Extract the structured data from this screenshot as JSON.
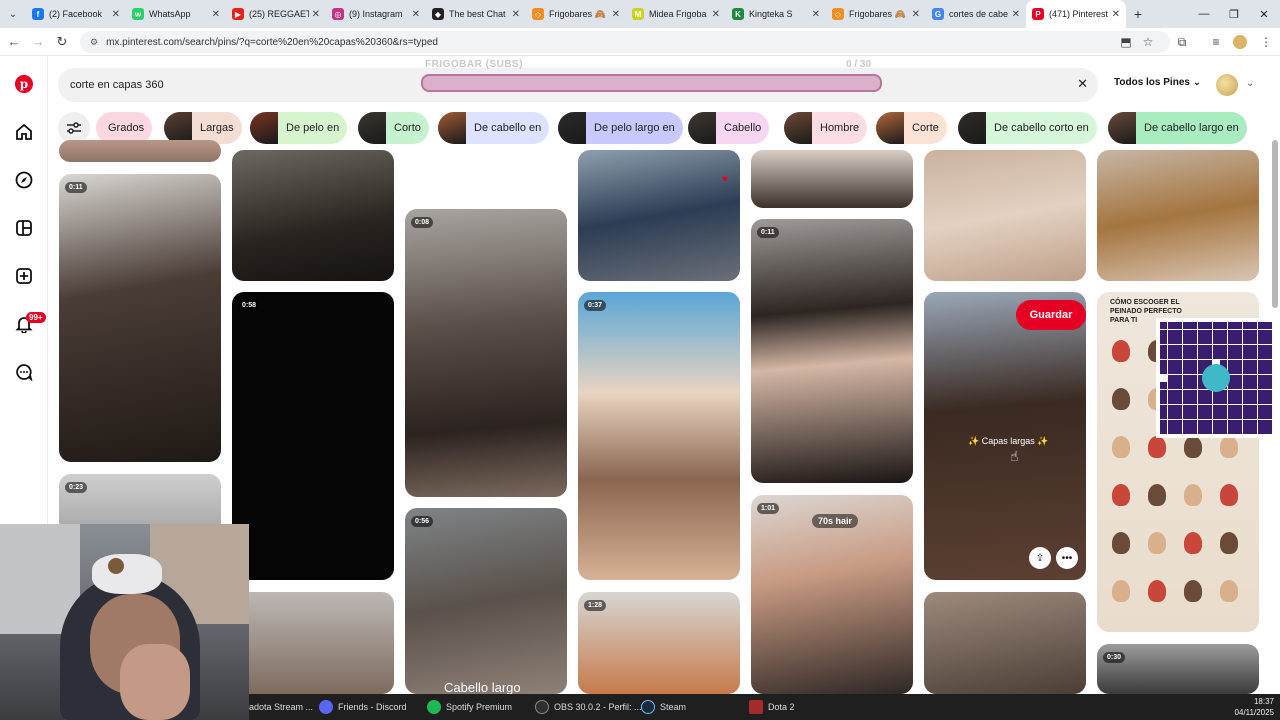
{
  "browser": {
    "tabs": [
      {
        "title": "(2) Facebook",
        "color": "#1877f2",
        "glyph": "f"
      },
      {
        "title": "WhatsApp",
        "color": "#25d366",
        "glyph": "w"
      },
      {
        "title": "(25) REGGAETO",
        "color": "#e62117",
        "glyph": "▶"
      },
      {
        "title": "(9) Instagram",
        "color": "#c13584",
        "glyph": "◎"
      },
      {
        "title": "The best Chat",
        "color": "#222222",
        "glyph": "◆"
      },
      {
        "title": "Frigobares 🙈",
        "color": "#f68b1e",
        "glyph": "◇"
      },
      {
        "title": "Midea Frigoba",
        "color": "#c7d31f",
        "glyph": "M"
      },
      {
        "title": "Kingteka S",
        "color": "#1c8a3e",
        "glyph": "K"
      },
      {
        "title": "Frigobares 🙈",
        "color": "#f68b1e",
        "glyph": "◇"
      },
      {
        "title": "cortes de cabe",
        "color": "#4285f4",
        "glyph": "G"
      },
      {
        "title": "(471) Pinterest",
        "color": "#e60023",
        "glyph": "P"
      }
    ],
    "url": "mx.pinterest.com/search/pins/?q=corte%20en%20capas%20360&rs=typed"
  },
  "search": {
    "query": "corte en capas 360",
    "filter": "Todos los Pines",
    "stream_overlay_label": "FRIGOBAR (SUBS)",
    "stream_overlay_count": "0 / 30"
  },
  "nav": {
    "notifications_badge": "99+"
  },
  "chips": [
    {
      "label": "Grados",
      "bg": "#fbd7e2",
      "thumb": null
    },
    {
      "label": "Largas",
      "bg": "#f4ded3",
      "thumb": "#5a4032"
    },
    {
      "label": "De pelo en",
      "bg": "#d6f5cf",
      "thumb": "#7a3524"
    },
    {
      "label": "Corto",
      "bg": "#c7f2d0",
      "thumb": "#3a3530"
    },
    {
      "label": "De cabello en",
      "bg": "#dde3ff",
      "thumb": "#a35b33"
    },
    {
      "label": "De pelo largo en",
      "bg": "#c9c8ff",
      "thumb": "#2b2a2a"
    },
    {
      "label": "Cabello",
      "bg": "#f7d6f2",
      "thumb": "#403731"
    },
    {
      "label": "Hombre",
      "bg": "#fcdde3",
      "thumb": "#6f4a36"
    },
    {
      "label": "Corte",
      "bg": "#fbe2d4",
      "thumb": "#b3673a"
    },
    {
      "label": "De cabello corto en",
      "bg": "#d6f6da",
      "thumb": "#2f2b28"
    },
    {
      "label": "De cabello largo en",
      "bg": "#a8ecc0",
      "thumb": "#6b4b3a"
    }
  ],
  "pins": {
    "durations": [
      "0:11",
      "0:23",
      "0:58",
      "0:08",
      "0:56",
      "0:37",
      "1:28",
      "0:11",
      "1:01",
      "0:30"
    ],
    "save_label": "Guardar",
    "tag_70s": "70s hair",
    "caption_capas": "✨ Capas largas ✨",
    "caption_cabello": "Cabello largo",
    "chart_heading": "CÓMO ESCOGER EL PEINADO PERFECTO PARA TI"
  },
  "taskbar": {
    "items": [
      "adota Stream ...",
      "Friends - Discord",
      "Spotify Premium",
      "OBS 30.0.2 - Perfil: ...",
      "Steam",
      "Dota 2"
    ],
    "time": "18:37",
    "date": "04/11/2025"
  },
  "colors": {
    "brand": "#e60023"
  }
}
